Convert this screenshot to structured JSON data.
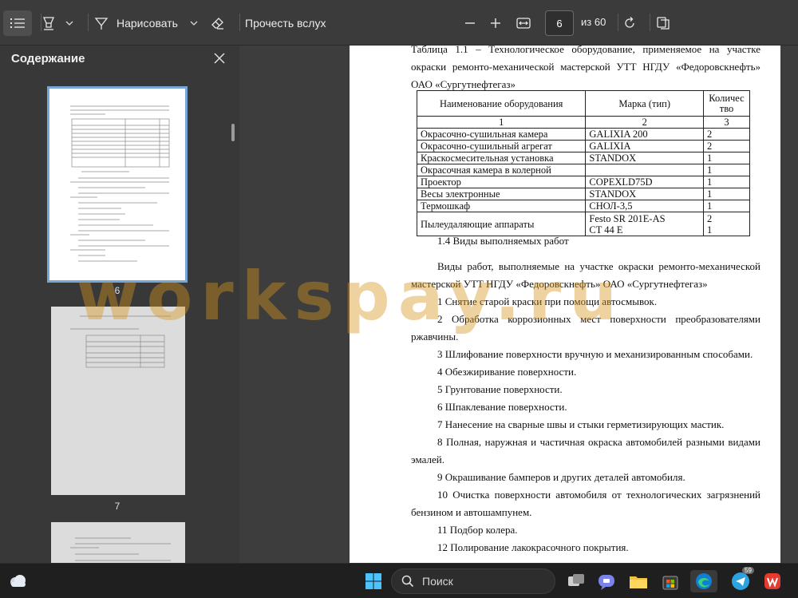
{
  "toolbar": {
    "draw_label": "Нарисовать",
    "read_aloud_label": "Прочесть вслух",
    "page_current": "6",
    "page_total": "из 60"
  },
  "sidebar": {
    "title": "Содержание",
    "thumbnails": [
      {
        "page": "6",
        "selected": true
      },
      {
        "page": "7",
        "selected": false
      }
    ]
  },
  "document": {
    "table_caption": "Таблица 1.1 – Технологическое оборудование, применяемое на участке окраски ремонто-механической мастерской УТТ НГДУ «Федоровскнефть» ОАО «Сургутнефтегаз»",
    "table": {
      "headers": [
        "Наименование оборудования",
        "Марка (тип)",
        "Количес тво"
      ],
      "index_row": [
        "1",
        "2",
        "3"
      ],
      "rows": [
        [
          "Окрасочно-сушильная камера",
          "GALIXIA 200",
          "2"
        ],
        [
          "Окрасочно-сушильный агрегат",
          "GALIXIA",
          "2"
        ],
        [
          "Краскосмесительная установка",
          "STANDOX",
          "1"
        ],
        [
          "Окрасочная камера в колерной",
          "",
          "1"
        ],
        [
          "Проектор",
          "COPEXLD75D",
          "1"
        ],
        [
          "Весы электронные",
          "STANDOX",
          "1"
        ],
        [
          "Термошкаф",
          "СНОЛ-3,5",
          "1"
        ],
        [
          "Пылеудаляющие аппараты",
          "Festo SR 201E-AS",
          "2"
        ]
      ],
      "last_row_extra": [
        "CT 44 E",
        "1"
      ]
    },
    "section_heading": "1.4 Виды выполняемых работ",
    "intro": "Виды работ, выполняемые на участке окраски ремонто-механической мастерской УТТ НГДУ «Федоровскнефть» ОАО «Сургутнефтегаз»",
    "items": [
      "1 Снятие старой краски при помощи автосмывок.",
      "2 Обработка коррозионных мест поверхности преобразователями ржавчины.",
      "3 Шлифование поверхности вручную и механизированным способами.",
      "4 Обезжиривание поверхности.",
      "5 Грунтование поверхности.",
      "6 Шпаклевание поверхности.",
      "7 Нанесение на сварные швы и стыки герметизирующих мастик.",
      "8 Полная, наружная и частичная окраска автомобилей разными видами эмалей.",
      "9 Окрашивание бамперов и других деталей автомобиля.",
      "10 Очистка поверхности автомобиля от технологических загрязнений бензином и автошампунем.",
      "11 Подбор колера.",
      "12 Полирование лакокрасочного покрытия."
    ]
  },
  "watermark": "workspay.ru",
  "taskbar": {
    "search_label": "Поиск",
    "telegram_badge": "59"
  },
  "colors": {
    "accent": "#74a6d6",
    "watermark": "#d6961e"
  }
}
